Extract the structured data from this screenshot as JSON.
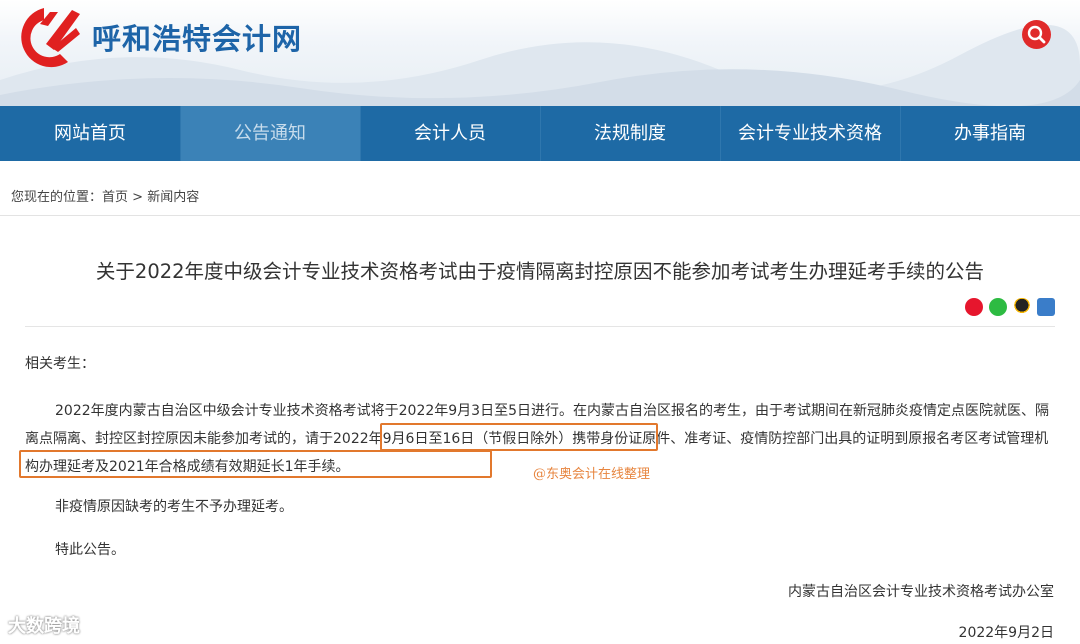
{
  "site": {
    "name": "呼和浩特会计网"
  },
  "nav": [
    {
      "label": "网站首页",
      "active": false
    },
    {
      "label": "公告通知",
      "active": true
    },
    {
      "label": "会计人员",
      "active": false
    },
    {
      "label": "法规制度",
      "active": false
    },
    {
      "label": "会计专业技术资格",
      "active": false
    },
    {
      "label": "办事指南",
      "active": false
    }
  ],
  "breadcrumb": {
    "prefix": "您现在的位置：",
    "home": "首页",
    "sep": ">",
    "current": "新闻内容"
  },
  "article": {
    "title": "关于2022年度中级会计专业技术资格考试由于疫情隔离封控原因不能参加考试考生办理延考手续的公告",
    "greeting": "相关考生：",
    "p1_part1": "2022年度内蒙古自治区中级会计专业技术资格考试将于2022年9月3日至5日进行。在内蒙古自治区报名的考生，由于考试期间在新冠肺炎疫情定点医院就医、隔离点隔离、封控区封控原因未能参加考试的，",
    "p1_highlight": "请于2022年9月6日至16日（节假日除外）",
    "p1_part2": "携带身份证原件、准考证、疫情防控部门出具的证明到原报名考区考试管理机构办理延考及2021年合格成绩有效期延长1年手续。",
    "p2": "非疫情原因缺考的考生不予办理延考。",
    "p3": "特此公告。",
    "signer": "内蒙古自治区会计专业技术资格考试办公室",
    "date": "2022年9月2日"
  },
  "watermark": "@东奥会计在线整理",
  "brand_watermark": "大数跨境",
  "share_icons": [
    "weibo-icon",
    "wechat-icon",
    "qq-icon",
    "print-icon"
  ],
  "colors": {
    "nav": "#1e6aa5",
    "nav_active": "#3b82b7",
    "brand": "#1d64a8",
    "highlight_border": "#e2782d",
    "search": "#e02a2a"
  }
}
